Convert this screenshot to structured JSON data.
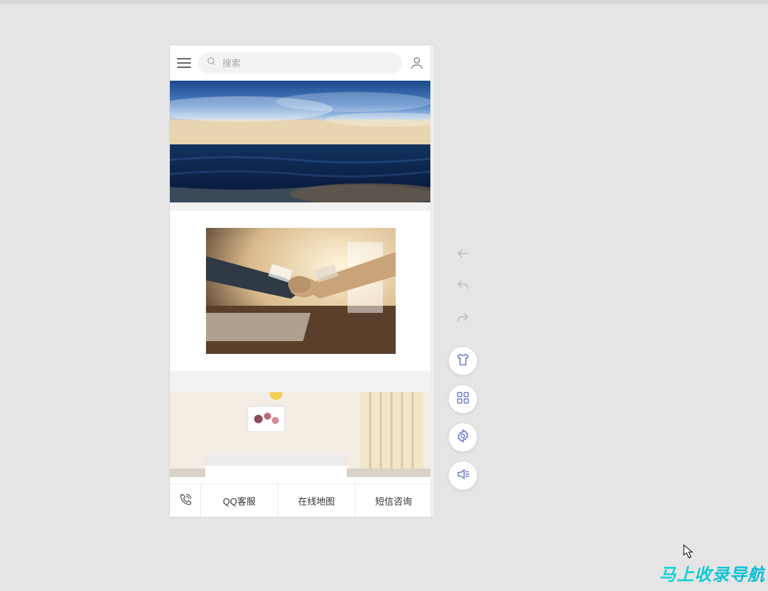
{
  "header": {
    "search_placeholder": "搜索"
  },
  "bottom_bar": {
    "items": [
      {
        "label": "QQ客服"
      },
      {
        "label": "在线地图"
      },
      {
        "label": "短信咨询"
      }
    ]
  },
  "side_tools": {
    "icons": [
      {
        "name": "back-arrow-icon"
      },
      {
        "name": "undo-icon"
      },
      {
        "name": "redo-icon"
      },
      {
        "name": "shirt-icon"
      },
      {
        "name": "grid-icon"
      },
      {
        "name": "gear-icon"
      },
      {
        "name": "speaker-icon"
      }
    ]
  },
  "watermark": "马上收录导航",
  "colors": {
    "accent": "#16d6d0",
    "tool_icon": "#6a7bcf"
  }
}
